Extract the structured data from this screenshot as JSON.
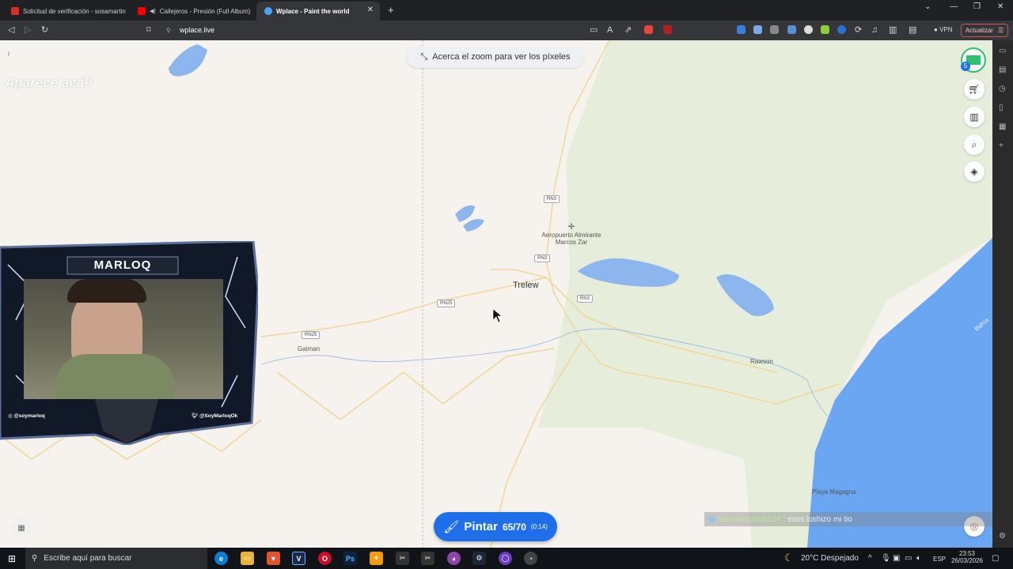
{
  "browser": {
    "tabs": [
      {
        "title": "Solicitud de verificación - sosamartin",
        "favicon": "gmail-icon",
        "color": "#d93025"
      },
      {
        "title": "Callejeros - Presión (Full Album)",
        "favicon": "youtube-icon",
        "color": "#ff0000"
      },
      {
        "title": "Wplace - Paint the world",
        "favicon": "globe-icon",
        "color": "#4aa3ff",
        "active": true
      }
    ],
    "new_tab": "+",
    "url": "wplace.live",
    "vpn_label": "VPN",
    "update_label": "Actualizar",
    "badge_count": "5"
  },
  "map": {
    "zoom_hint": "Acerca el zoom para ver los píxeles",
    "roads": [
      "RN3",
      "RN3",
      "RN25",
      "RN3",
      "RN25"
    ],
    "places": {
      "airport_line1": "Aeropuerto Almirante",
      "airport_line2": "Marcos Zar",
      "trelew": "Trelew",
      "gaiman": "Gaiman",
      "rawson": "Rawson",
      "playa": "Playa Magagna",
      "bay": "Bahía"
    },
    "left_info": "i",
    "overlay_text": "Aparece acá!!",
    "user_badge": "5"
  },
  "paint_button": {
    "label": "Pintar",
    "count": "65/70",
    "timer": "(0:14)"
  },
  "chat": {
    "user": "saimoonciclon124",
    "message": " : esos loshizo mi tio"
  },
  "webcam": {
    "name": "MARLOQ",
    "instagram": "@soymarloq",
    "twitter": "@SoyMarloqOk"
  },
  "taskbar": {
    "search_placeholder": "Escribe aquí para buscar",
    "weather": "20°C  Despejado",
    "lang": "ESP",
    "time": "23:53",
    "date": "26/03/2026"
  },
  "colors": {
    "map_bg": "#f6f3ee",
    "green": "#e6eedb",
    "water": "#6aa6f2",
    "road": "#f2d79a",
    "accent": "#1f6feb"
  }
}
